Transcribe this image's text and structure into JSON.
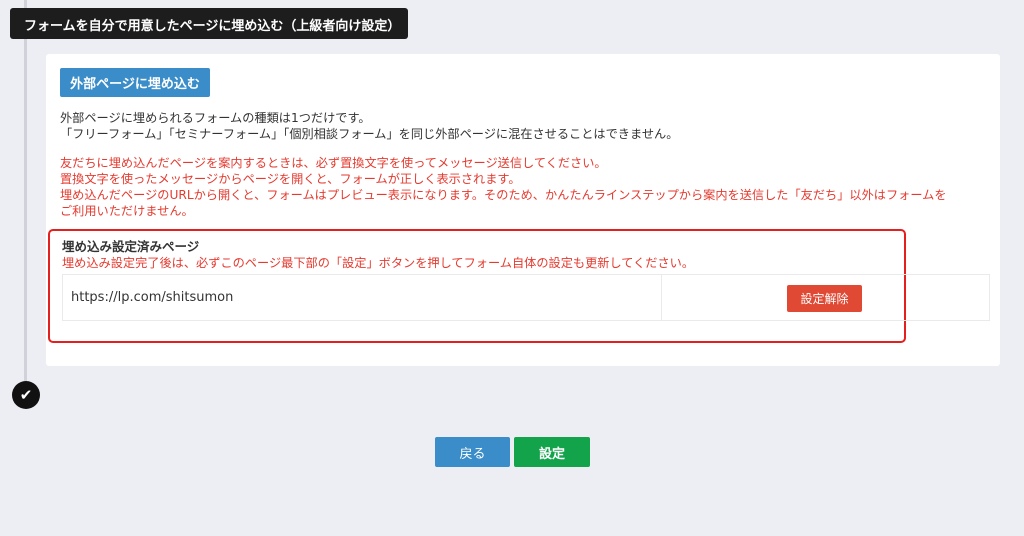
{
  "header": {
    "title": "フォームを自分で用意したページに埋め込む（上級者向け設定）"
  },
  "panel": {
    "embed_button_label": "外部ページに埋め込む",
    "info_lines": [
      "外部ページに埋められるフォームの種類は1つだけです。",
      "「フリーフォーム」「セミナーフォーム」「個別相談フォーム」を同じ外部ページに混在させることはできません。"
    ],
    "warning_lines": [
      "友だちに埋め込んだページを案内するときは、必ず置換文字を使ってメッセージ送信してください。",
      "置換文字を使ったメッセージからページを開くと、フォームが正しく表示されます。",
      "埋め込んだページのURLから開くと、フォームはプレビュー表示になります。そのため、かんたんラインステップから案内を送信した「友だち」以外はフォームを",
      "ご利用いただけません。"
    ]
  },
  "embedded": {
    "title": "埋め込み設定済みページ",
    "note": "埋め込み設定完了後は、必ずこのページ最下部の「設定」ボタンを押してフォーム自体の設定も更新してください。",
    "url": "https://lp.com/shitsumon",
    "unset_button_label": "設定解除"
  },
  "footer": {
    "back_label": "戻る",
    "save_label": "設定"
  },
  "colors": {
    "accent_blue": "#3a8dc8",
    "warning_red": "#e53a2f",
    "highlight_border": "#e51e1e",
    "save_green": "#13a34b",
    "unset_red": "#e04a35"
  },
  "icons": {
    "step_complete": "check-icon"
  }
}
